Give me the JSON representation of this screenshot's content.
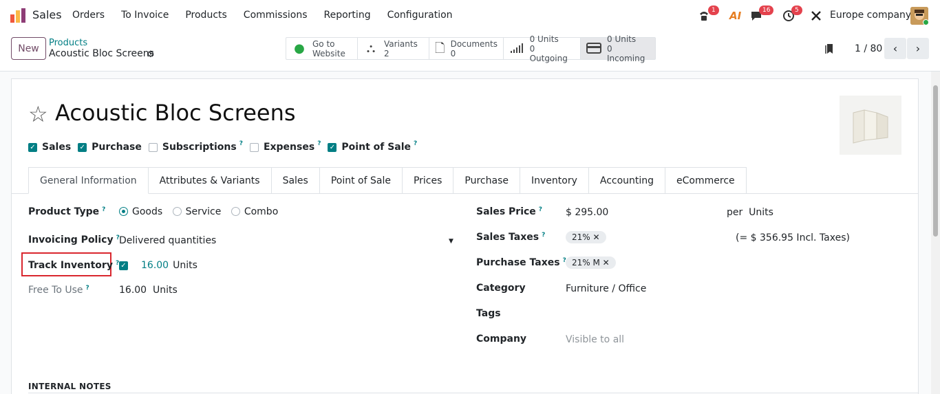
{
  "navbar": {
    "app_name": "Sales",
    "menu": [
      "Orders",
      "To Invoice",
      "Products",
      "Commissions",
      "Reporting",
      "Configuration"
    ],
    "badges": {
      "calls": "1",
      "messages": "16",
      "activities": "5"
    },
    "ai_label": "AI",
    "company": "Europe company"
  },
  "control": {
    "new_label": "New",
    "breadcrumb_parent": "Products",
    "breadcrumb_current": "Acoustic Bloc Screens",
    "smart_buttons": {
      "website": {
        "line1": "Go to",
        "line2": "Website"
      },
      "variants": {
        "line1": "Variants",
        "line2": "2"
      },
      "documents": {
        "line1": "Documents",
        "line2": "0"
      },
      "outgoing": {
        "line1": "0 Units",
        "line2": "0 Outgoing"
      },
      "incoming": {
        "line1": "0 Units",
        "line2": "0 Incoming"
      }
    },
    "pager": "1 / 80"
  },
  "form": {
    "title": "Acoustic Bloc Screens",
    "checkboxes": [
      {
        "label": "Sales",
        "checked": true
      },
      {
        "label": "Purchase",
        "checked": true
      },
      {
        "label": "Subscriptions",
        "checked": false
      },
      {
        "label": "Expenses",
        "checked": false
      },
      {
        "label": "Point of Sale",
        "checked": true
      }
    ],
    "help_mark": "?",
    "tabs": [
      "General Information",
      "Attributes & Variants",
      "Sales",
      "Point of Sale",
      "Prices",
      "Purchase",
      "Inventory",
      "Accounting",
      "eCommerce"
    ],
    "product_type": {
      "label": "Product Type",
      "options": [
        "Goods",
        "Service",
        "Combo"
      ],
      "selected": "Goods"
    },
    "invoicing_policy": {
      "label": "Invoicing Policy",
      "value": "Delivered quantities"
    },
    "track_inventory": {
      "label": "Track Inventory",
      "qty": "16.00",
      "unit": "Units"
    },
    "free_to_use": {
      "label": "Free To Use",
      "qty": "16.00",
      "unit": "Units"
    },
    "sales_price": {
      "label": "Sales Price",
      "value": "$ 295.00",
      "per": "per",
      "unit": "Units"
    },
    "sales_taxes": {
      "label": "Sales Taxes",
      "tag": "21%",
      "incl": "(= $ 356.95 Incl. Taxes)"
    },
    "purchase_taxes": {
      "label": "Purchase Taxes",
      "tag": "21% M"
    },
    "category": {
      "label": "Category",
      "value": "Furniture / Office"
    },
    "tags": {
      "label": "Tags"
    },
    "company": {
      "label": "Company",
      "placeholder": "Visible to all"
    },
    "internal_notes": "INTERNAL NOTES"
  },
  "colors": {
    "brand": "#714b67",
    "accent": "#017e84",
    "highlight": "#d9262e",
    "badge": "#e4424d"
  }
}
